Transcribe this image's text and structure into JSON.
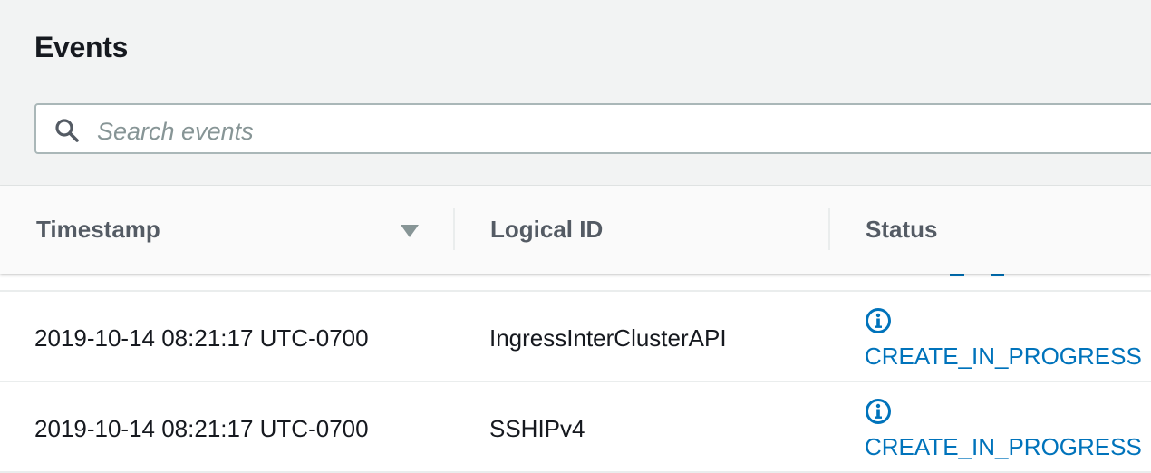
{
  "panel": {
    "title": "Events"
  },
  "search": {
    "placeholder": "Search events"
  },
  "table": {
    "columns": [
      {
        "label": "Timestamp",
        "sorted": "descending"
      },
      {
        "label": "Logical ID"
      },
      {
        "label": "Status"
      }
    ],
    "rows": [
      {
        "timestamp": "2019-10-14 08:21:17 UTC-0700",
        "logical_id": "IngressInterClusterAPI",
        "status": "CREATE_IN_PROGRESS",
        "status_icon": "info-circle-icon"
      },
      {
        "timestamp": "2019-10-14 08:21:17 UTC-0700",
        "logical_id": "SSHIPv4",
        "status": "CREATE_IN_PROGRESS",
        "status_icon": "info-circle-icon"
      }
    ]
  },
  "colors": {
    "background": "#f2f3f3",
    "link": "#0073bb",
    "header_text": "#545b64",
    "body_text": "#16191f"
  }
}
